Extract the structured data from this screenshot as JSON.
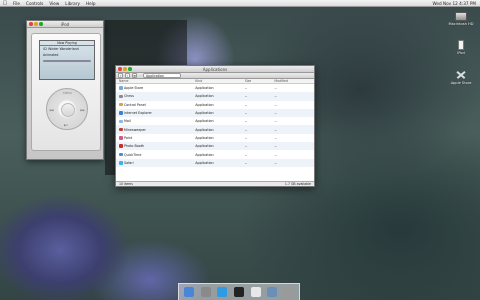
{
  "menubar": {
    "apple": "",
    "items": [
      "File",
      "Controls",
      "View",
      "Library",
      "Help"
    ],
    "clock": "Wed Nov 12 4:37 PM"
  },
  "desktop": [
    {
      "label": "Macintosh HD",
      "icon": "hard-drive-icon"
    },
    {
      "label": "iPod",
      "icon": "ipod-icon"
    },
    {
      "label": "Apple Store",
      "icon": "app-store-icon"
    }
  ],
  "ipod_window": {
    "title": "iPod",
    "screen_header": "Now Playing",
    "track": "02 Winter Wonderland",
    "artist": "Animated"
  },
  "wheel": {
    "menu": "MENU",
    "next": "▶▶",
    "prev": "◀◀",
    "play": "▶II"
  },
  "finder": {
    "title": "Applications",
    "search_value": "Application",
    "columns": [
      "Name",
      "Kind",
      "Size",
      "Modified"
    ],
    "rows": [
      {
        "name": "Apple Store",
        "kind": "Application",
        "size": "--",
        "date": "--",
        "color": "#7aa7d8"
      },
      {
        "name": "Chess",
        "kind": "Application",
        "size": "--",
        "date": "--",
        "color": "#8b8b8b"
      },
      {
        "name": "Control Panel",
        "kind": "Application",
        "size": "--",
        "date": "--",
        "color": "#e0a13c"
      },
      {
        "name": "Internet Explorer",
        "kind": "Application",
        "size": "--",
        "date": "--",
        "color": "#3e7fd0"
      },
      {
        "name": "Mail",
        "kind": "Application",
        "size": "--",
        "date": "--",
        "color": "#8fb6e6"
      },
      {
        "name": "Minesweeper",
        "kind": "Application",
        "size": "--",
        "date": "--",
        "color": "#c0402f"
      },
      {
        "name": "Paint",
        "kind": "Application",
        "size": "--",
        "date": "--",
        "color": "#cf5a84"
      },
      {
        "name": "Photo Booth",
        "kind": "Application",
        "size": "--",
        "date": "--",
        "color": "#c9302c"
      },
      {
        "name": "QuickTime",
        "kind": "Application",
        "size": "--",
        "date": "--",
        "color": "#4f8ad8"
      },
      {
        "name": "Safari",
        "kind": "Application",
        "size": "--",
        "date": "--",
        "color": "#3db2e8"
      }
    ],
    "status_items": "10 items",
    "status_size": "1.7 GB available"
  },
  "dock": [
    {
      "name": "finder-icon",
      "color": "#4a86d6"
    },
    {
      "name": "system-prefs-icon",
      "color": "#8a8a8a"
    },
    {
      "name": "safari-icon",
      "color": "#2f9be0"
    },
    {
      "name": "terminal-icon",
      "color": "#222"
    },
    {
      "name": "ipod-dock-icon",
      "color": "#e8e8e8"
    },
    {
      "name": "applications-icon",
      "color": "#6c8fb8"
    },
    {
      "name": "trash-icon",
      "color": "#9a9a9a"
    }
  ]
}
